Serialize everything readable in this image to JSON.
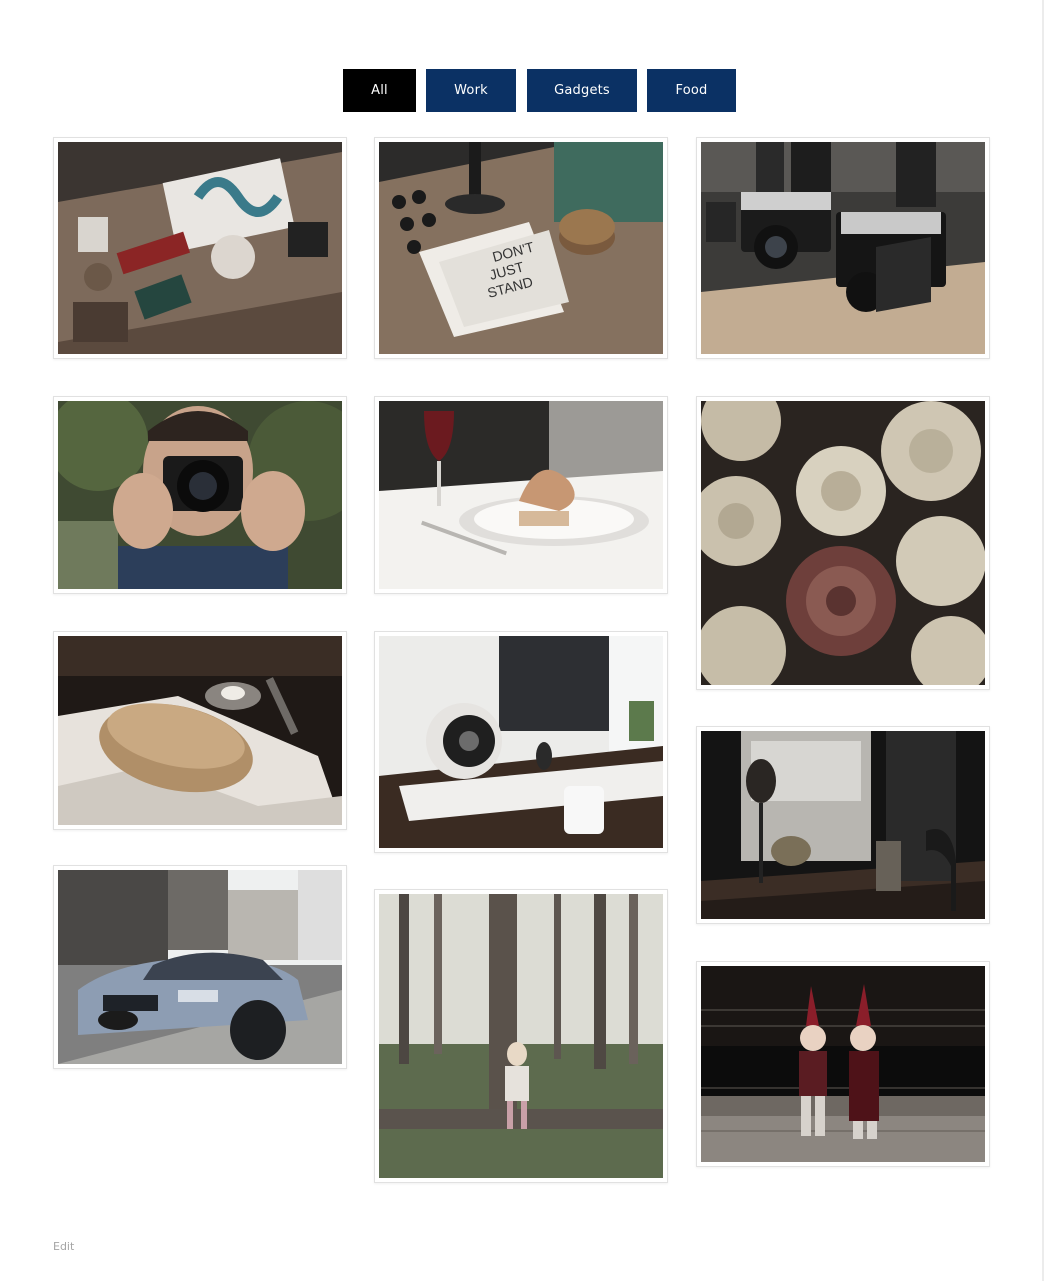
{
  "filters": [
    {
      "label": "All",
      "active": true
    },
    {
      "label": "Work",
      "active": false
    },
    {
      "label": "Gadgets",
      "active": false
    },
    {
      "label": "Food",
      "active": false
    }
  ],
  "gallery": {
    "items": [
      {
        "name": "photo-desk-flatlay",
        "category": "Work"
      },
      {
        "name": "photo-notebook-desk",
        "category": "Work"
      },
      {
        "name": "photo-vintage-cameras",
        "category": "Gadgets"
      },
      {
        "name": "photo-man-with-camera",
        "category": "Gadgets"
      },
      {
        "name": "photo-dinner-plate",
        "category": "Food"
      },
      {
        "name": "photo-roses",
        "category": "All"
      },
      {
        "name": "photo-bread-loaf",
        "category": "Food"
      },
      {
        "name": "photo-speaker-workspace",
        "category": "Gadgets"
      },
      {
        "name": "photo-mannequin-window",
        "category": "Work"
      },
      {
        "name": "photo-silver-car",
        "category": "Gadgets"
      },
      {
        "name": "photo-girl-in-forest",
        "category": "All"
      },
      {
        "name": "photo-figurines",
        "category": "All"
      }
    ]
  },
  "footer": {
    "edit_label": "Edit"
  },
  "colors": {
    "active_filter": "#000000",
    "filter": "#0b3164",
    "card_border": "#e1e1e1"
  }
}
